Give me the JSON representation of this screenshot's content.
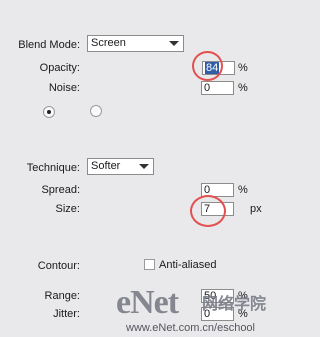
{
  "blend_mode": {
    "label": "Blend Mode:",
    "value": "Screen"
  },
  "opacity": {
    "label": "Opacity:",
    "value": "84",
    "unit": "%"
  },
  "noise": {
    "label": "Noise:",
    "value": "0",
    "unit": "%"
  },
  "technique": {
    "label": "Technique:",
    "value": "Softer"
  },
  "spread": {
    "label": "Spread:",
    "value": "0",
    "unit": "%"
  },
  "size": {
    "label": "Size:",
    "value": "7",
    "unit": "px"
  },
  "contour": {
    "label": "Contour:",
    "anti_aliased_label": "Anti-aliased"
  },
  "range": {
    "label": "Range:",
    "value": "50",
    "unit": "%"
  },
  "jitter": {
    "label": "Jitter:",
    "value": "0",
    "unit": "%"
  },
  "watermark": {
    "logo": "eNet",
    "chinese": "网络学院",
    "url": "www.eNet.com.cn/eschool"
  },
  "colors": {
    "highlight_circle": "#e2504f",
    "background": "#e9e9eb"
  }
}
